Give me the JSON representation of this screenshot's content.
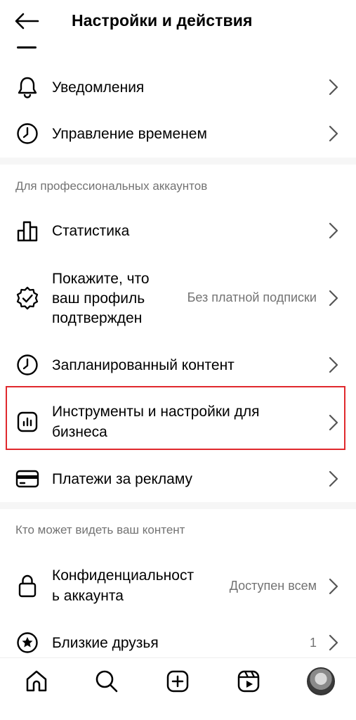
{
  "header": {
    "title": "Настройки и действия"
  },
  "rows": {
    "notifications": {
      "label": "Уведомления"
    },
    "time": {
      "label": "Управление временем"
    },
    "stats": {
      "label": "Статистика"
    },
    "verify": {
      "label": "Покажите, что ваш профиль подтвержден",
      "line1": "Покажите, что",
      "line2": "ваш профиль",
      "line3": "подтвержден",
      "value": "Без платной подписки"
    },
    "scheduled": {
      "label": "Запланированный контент"
    },
    "business": {
      "line1": "Инструменты и настройки для",
      "line2": "бизнеса"
    },
    "ads": {
      "label": "Платежи за рекламу"
    },
    "privacy": {
      "line1": "Конфиденциальност",
      "line2": "ь аккаунта",
      "value": "Доступен всем"
    },
    "close_friends": {
      "label": "Близкие друзья",
      "value": "1"
    }
  },
  "sections": {
    "pro": "Для профессиональных аккаунтов",
    "visibility": "Кто может видеть ваш контент"
  },
  "icons": {
    "back": "arrow-left-icon",
    "notifications": "bell-icon",
    "time": "clock-icon",
    "stats": "bar-chart-icon",
    "verify": "verified-badge-icon",
    "scheduled": "clock-icon",
    "business": "chart-square-icon",
    "ads": "credit-card-icon",
    "privacy": "lock-icon",
    "close_friends": "star-circle-icon",
    "chevron": "chevron-right-icon"
  },
  "colors": {
    "highlight": "#e0282d",
    "secondary_text": "#737373"
  },
  "bottom_nav": [
    "home-icon",
    "search-icon",
    "create-icon",
    "reels-icon",
    "profile-avatar"
  ]
}
